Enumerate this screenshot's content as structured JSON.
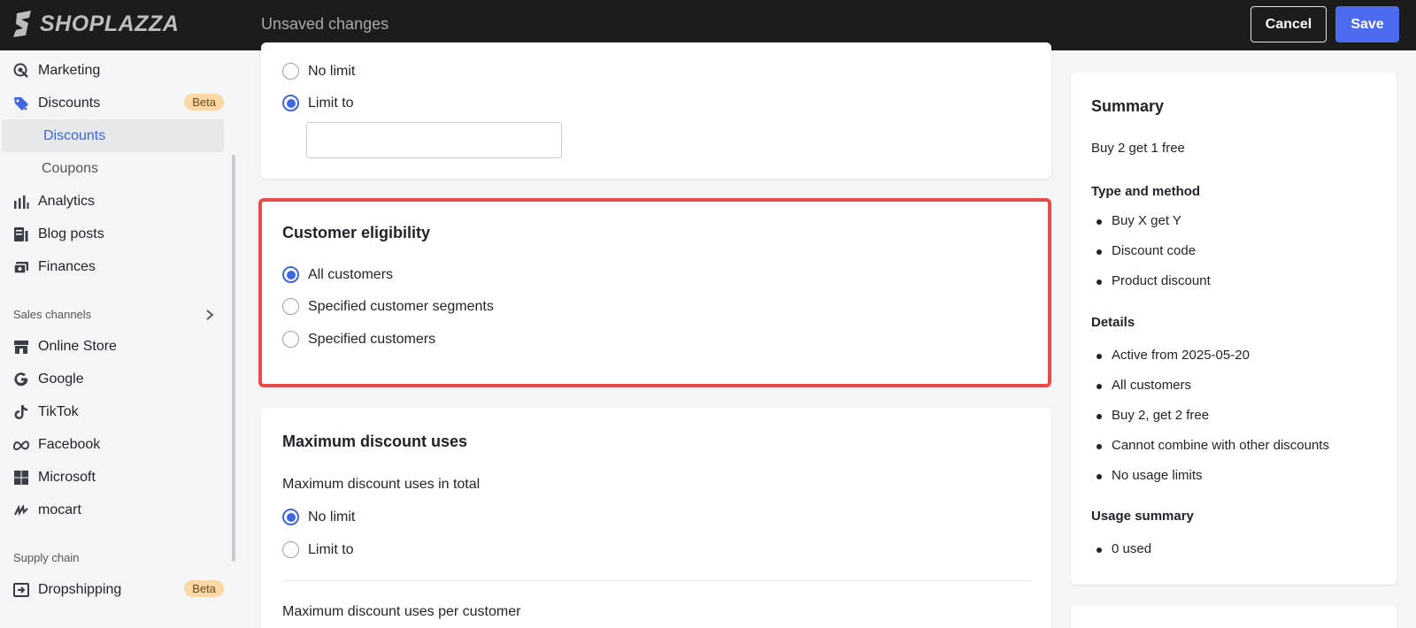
{
  "app": {
    "logo_text": "SHOPLAZZA"
  },
  "header": {
    "status": "Unsaved changes",
    "cancel_label": "Cancel",
    "save_label": "Save"
  },
  "sidebar": {
    "items": [
      {
        "label": "Marketing",
        "icon": "marketing-icon"
      },
      {
        "label": "Discounts",
        "icon": "discount-tag-icon",
        "badge": "Beta"
      },
      {
        "label": "Discounts",
        "active": true
      },
      {
        "label": "Coupons"
      },
      {
        "label": "Analytics",
        "icon": "analytics-icon"
      },
      {
        "label": "Blog posts",
        "icon": "blog-icon"
      },
      {
        "label": "Finances",
        "icon": "finances-icon"
      }
    ],
    "sales_channels_label": "Sales channels",
    "channels": [
      {
        "label": "Online Store",
        "icon": "store-icon"
      },
      {
        "label": "Google",
        "icon": "google-icon"
      },
      {
        "label": "TikTok",
        "icon": "tiktok-icon"
      },
      {
        "label": "Facebook",
        "icon": "meta-icon"
      },
      {
        "label": "Microsoft",
        "icon": "microsoft-icon"
      },
      {
        "label": "mocart",
        "icon": "mocart-icon"
      }
    ],
    "supply_chain_label": "Supply chain",
    "supply": [
      {
        "label": "Dropshipping",
        "icon": "dropshipping-icon",
        "badge": "Beta"
      }
    ]
  },
  "limit_card": {
    "options": [
      "No limit",
      "Limit to"
    ],
    "selected": "Limit to",
    "input_value": ""
  },
  "eligibility_card": {
    "title": "Customer eligibility",
    "options": [
      "All customers",
      "Specified customer segments",
      "Specified customers"
    ],
    "selected": "All customers"
  },
  "max_uses_card": {
    "title": "Maximum discount uses",
    "total_label": "Maximum discount uses in total",
    "options": [
      "No limit",
      "Limit to"
    ],
    "selected": "No limit",
    "per_customer_label": "Maximum discount uses per customer"
  },
  "summary": {
    "title": "Summary",
    "name": "Buy 2 get 1 free",
    "type_heading": "Type and method",
    "type_items": [
      "Buy X get Y",
      "Discount code",
      "Product discount"
    ],
    "details_heading": "Details",
    "details_items": [
      "Active from 2025-05-20",
      "All customers",
      "Buy 2, get 2 free",
      "Cannot combine with other discounts",
      "No usage limits"
    ],
    "usage_heading": "Usage summary",
    "usage_items": [
      "0 used"
    ]
  },
  "colors": {
    "accent": "#4065e0",
    "highlight": "#e94b4b",
    "topbar": "#1c1c1c",
    "badge": "#fdd8a7"
  }
}
